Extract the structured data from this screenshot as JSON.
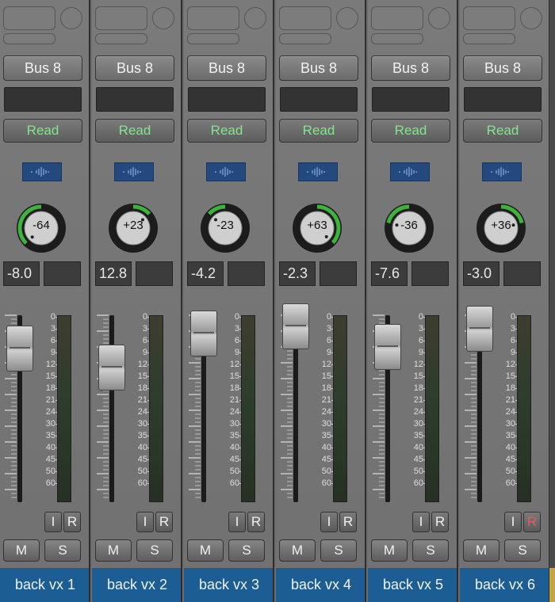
{
  "colors": {
    "read_text": "#7fe88a",
    "pan_arc": "#3db33b",
    "name_bar": "#1c5d94",
    "record_active": "#e85a5a"
  },
  "scale_labels": [
    "0",
    "3",
    "6",
    "9",
    "12",
    "15",
    "18",
    "21",
    "24",
    "30",
    "35",
    "40",
    "45",
    "50",
    "60"
  ],
  "channels": [
    {
      "output": "Bus 8",
      "automation": "Read",
      "pan": "-64",
      "pan_value": -64,
      "volume": "-8.0",
      "fader_db": -8.0,
      "input_label": "I",
      "record_label": "R",
      "record_active": false,
      "mute_label": "M",
      "solo_label": "S",
      "name": "back vx 1"
    },
    {
      "output": "Bus 8",
      "automation": "Read",
      "pan": "+23",
      "pan_value": 23,
      "volume": "12.8",
      "fader_db": -12.8,
      "input_label": "I",
      "record_label": "R",
      "record_active": false,
      "mute_label": "M",
      "solo_label": "S",
      "name": "back vx 2"
    },
    {
      "output": "Bus 8",
      "automation": "Read",
      "pan": "-23",
      "pan_value": -23,
      "volume": "-4.2",
      "fader_db": -4.2,
      "input_label": "I",
      "record_label": "R",
      "record_active": false,
      "mute_label": "M",
      "solo_label": "S",
      "name": "back vx 3"
    },
    {
      "output": "Bus 8",
      "automation": "Read",
      "pan": "+63",
      "pan_value": 63,
      "volume": "-2.3",
      "fader_db": -2.3,
      "input_label": "I",
      "record_label": "R",
      "record_active": false,
      "mute_label": "M",
      "solo_label": "S",
      "name": "back vx 4"
    },
    {
      "output": "Bus 8",
      "automation": "Read",
      "pan": "-36",
      "pan_value": -36,
      "volume": "-7.6",
      "fader_db": -7.6,
      "input_label": "I",
      "record_label": "R",
      "record_active": false,
      "mute_label": "M",
      "solo_label": "S",
      "name": "back vx 5"
    },
    {
      "output": "Bus 8",
      "automation": "Read",
      "pan": "+36",
      "pan_value": 36,
      "volume": "-3.0",
      "fader_db": -3.0,
      "input_label": "I",
      "record_label": "R",
      "record_active": true,
      "mute_label": "M",
      "solo_label": "S",
      "name": "back vx 6"
    }
  ]
}
